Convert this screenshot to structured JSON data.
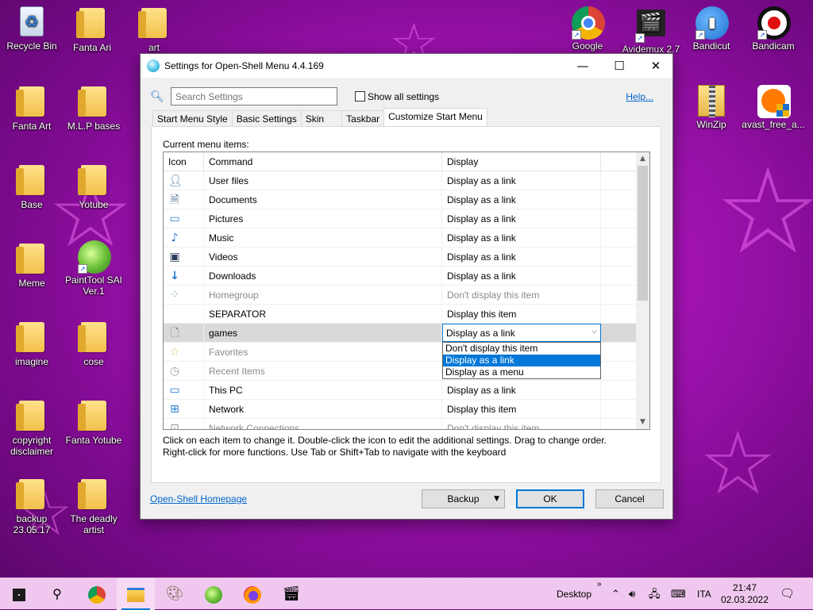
{
  "desktop": {
    "icons": [
      {
        "label": "Recycle Bin"
      },
      {
        "label": "Fanta Ari"
      },
      {
        "label": "art"
      },
      {
        "label": "Fanta Art"
      },
      {
        "label": "M.L.P bases"
      },
      {
        "label": "Base"
      },
      {
        "label": "Yotube"
      },
      {
        "label": "Meme"
      },
      {
        "label": "PaintTool SAI Ver.1"
      },
      {
        "label": "imagine"
      },
      {
        "label": "cose"
      },
      {
        "label": "copyright disclaimer"
      },
      {
        "label": "Fanta Yotube"
      },
      {
        "label": "backup 23.05.17"
      },
      {
        "label": "The deadly artist"
      },
      {
        "label": "Google"
      },
      {
        "label": "Avidemux 2.7"
      },
      {
        "label": "Bandicut"
      },
      {
        "label": "Bandicam"
      },
      {
        "label": "WinZip"
      },
      {
        "label": "avast_free_a..."
      }
    ]
  },
  "dialog": {
    "title": "Settings for Open-Shell Menu 4.4.169",
    "search_placeholder": "Search Settings",
    "show_all_label": "Show all settings",
    "help_label": "Help...",
    "tabs": [
      "Start Menu Style",
      "Basic Settings",
      "Skin",
      "Taskbar",
      "Customize Start Menu"
    ],
    "active_tab": "Customize Start Menu",
    "current_items_label": "Current menu items:",
    "columns": [
      "Icon",
      "Command",
      "Display"
    ],
    "rows": [
      {
        "icon": "user-icon",
        "command": "User files",
        "display": "Display as a link",
        "dim": false
      },
      {
        "icon": "documents-icon",
        "command": "Documents",
        "display": "Display as a link",
        "dim": false
      },
      {
        "icon": "pictures-icon",
        "command": "Pictures",
        "display": "Display as a link",
        "dim": false
      },
      {
        "icon": "music-icon",
        "command": "Music",
        "display": "Display as a link",
        "dim": false
      },
      {
        "icon": "videos-icon",
        "command": "Videos",
        "display": "Display as a link",
        "dim": false
      },
      {
        "icon": "downloads-icon",
        "command": "Downloads",
        "display": "Display as a link",
        "dim": false
      },
      {
        "icon": "homegroup-icon",
        "command": "Homegroup",
        "display": "Don't display this item",
        "dim": true
      },
      {
        "icon": "",
        "command": "SEPARATOR",
        "display": "Display this item",
        "dim": false
      },
      {
        "icon": "blank-page-icon",
        "command": "games",
        "display": "Display as a link",
        "dim": false
      },
      {
        "icon": "favorites-star-icon",
        "command": "Favorites",
        "display": "",
        "dim": true
      },
      {
        "icon": "recent-items-icon",
        "command": "Recent Items",
        "display": "",
        "dim": true
      },
      {
        "icon": "this-pc-icon",
        "command": "This PC",
        "display": "Display as a link",
        "dim": false
      },
      {
        "icon": "network-icon",
        "command": "Network",
        "display": "Display this item",
        "dim": false
      },
      {
        "icon": "network-connections-icon",
        "command": "Network Connections",
        "display": "Don't display this item",
        "dim": true
      }
    ],
    "combo_value": "Display as a link",
    "dropdown_options": [
      "Don't display this item",
      "Display as a link",
      "Display as a menu"
    ],
    "dropdown_selected": "Display as a link",
    "hint_line1": "Click on each item to change it. Double-click the icon to edit the additional settings. Drag to change order.",
    "hint_line2": "Right-click for more functions. Use Tab or Shift+Tab to navigate with the keyboard",
    "homepage_link": "Open-Shell Homepage",
    "backup_label": "Backup",
    "ok_label": "OK",
    "cancel_label": "Cancel"
  },
  "taskbar": {
    "desktop_label": "Desktop",
    "language": "ITA",
    "time": "21:47",
    "date": "02.03.2022"
  },
  "colors": {
    "accent": "#0078d7",
    "link": "#0066cc",
    "desktop_bg": "#a514b5",
    "taskbar_bg": "#f0c8ef"
  }
}
